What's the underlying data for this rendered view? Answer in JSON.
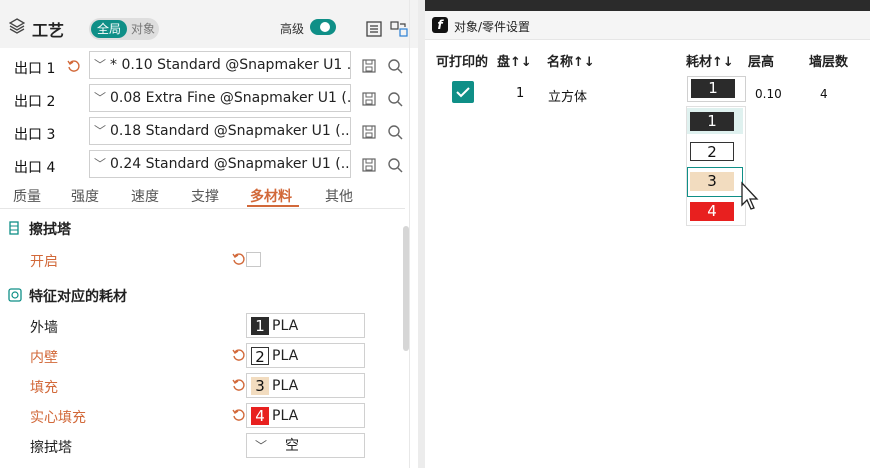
{
  "left_panel": {
    "title": "工艺",
    "scope_toggle": {
      "global_label": "全局",
      "object_label": "对象"
    },
    "advanced_label": "高级",
    "outlets": [
      {
        "label": "出口 1",
        "profile": "* 0.10 Standard @Snapmaker U1 ..."
      },
      {
        "label": "出口 2",
        "profile": "0.08 Extra Fine @Snapmaker U1 (..."
      },
      {
        "label": "出口 3",
        "profile": "0.18 Standard @Snapmaker U1 (..."
      },
      {
        "label": "出口 4",
        "profile": "0.24 Standard @Snapmaker U1 (..."
      }
    ],
    "tabs": [
      "质量",
      "强度",
      "速度",
      "支撑",
      "多材料",
      "其他"
    ],
    "active_tab": "多材料",
    "sections": {
      "wipe_tower": {
        "title": "擦拭塔",
        "enable_label": "开启"
      },
      "feature_filaments": {
        "title": "特征对应的耗材",
        "rows": [
          {
            "label": "外墙",
            "num": "1",
            "material": "PLA",
            "color": "#2b2b2b",
            "text_color": "#ffffff"
          },
          {
            "label": "内壁",
            "num": "2",
            "material": "PLA",
            "color": "#ffffff",
            "text_color": "#111111"
          },
          {
            "label": "填充",
            "num": "3",
            "material": "PLA",
            "color": "#f2dcbf",
            "text_color": "#111111"
          },
          {
            "label": "实心填充",
            "num": "4",
            "material": "PLA",
            "color": "#e8201f",
            "text_color": "#ffffff"
          },
          {
            "label": "擦拭塔",
            "value": "空"
          }
        ]
      }
    }
  },
  "right_panel": {
    "window_title": "对象/零件设置",
    "columns": [
      "可打印的",
      "盘↑↓",
      "名称↑↓",
      "耗材↑↓",
      "层高",
      "墙层数"
    ],
    "row": {
      "plate": "1",
      "name": "立方体",
      "filament": "1",
      "layer_height": "0.10",
      "walls": "4"
    },
    "dropdown_options": [
      {
        "num": "1",
        "color": "#2b2b2b",
        "text_color": "#ffffff"
      },
      {
        "num": "2",
        "color": "#ffffff",
        "text_color": "#111111"
      },
      {
        "num": "3",
        "color": "#f2dcbf",
        "text_color": "#111111"
      },
      {
        "num": "4",
        "color": "#e8201f",
        "text_color": "#ffffff"
      }
    ]
  },
  "colors": {
    "accent": "#0f8f87",
    "orange": "#d2693a"
  }
}
